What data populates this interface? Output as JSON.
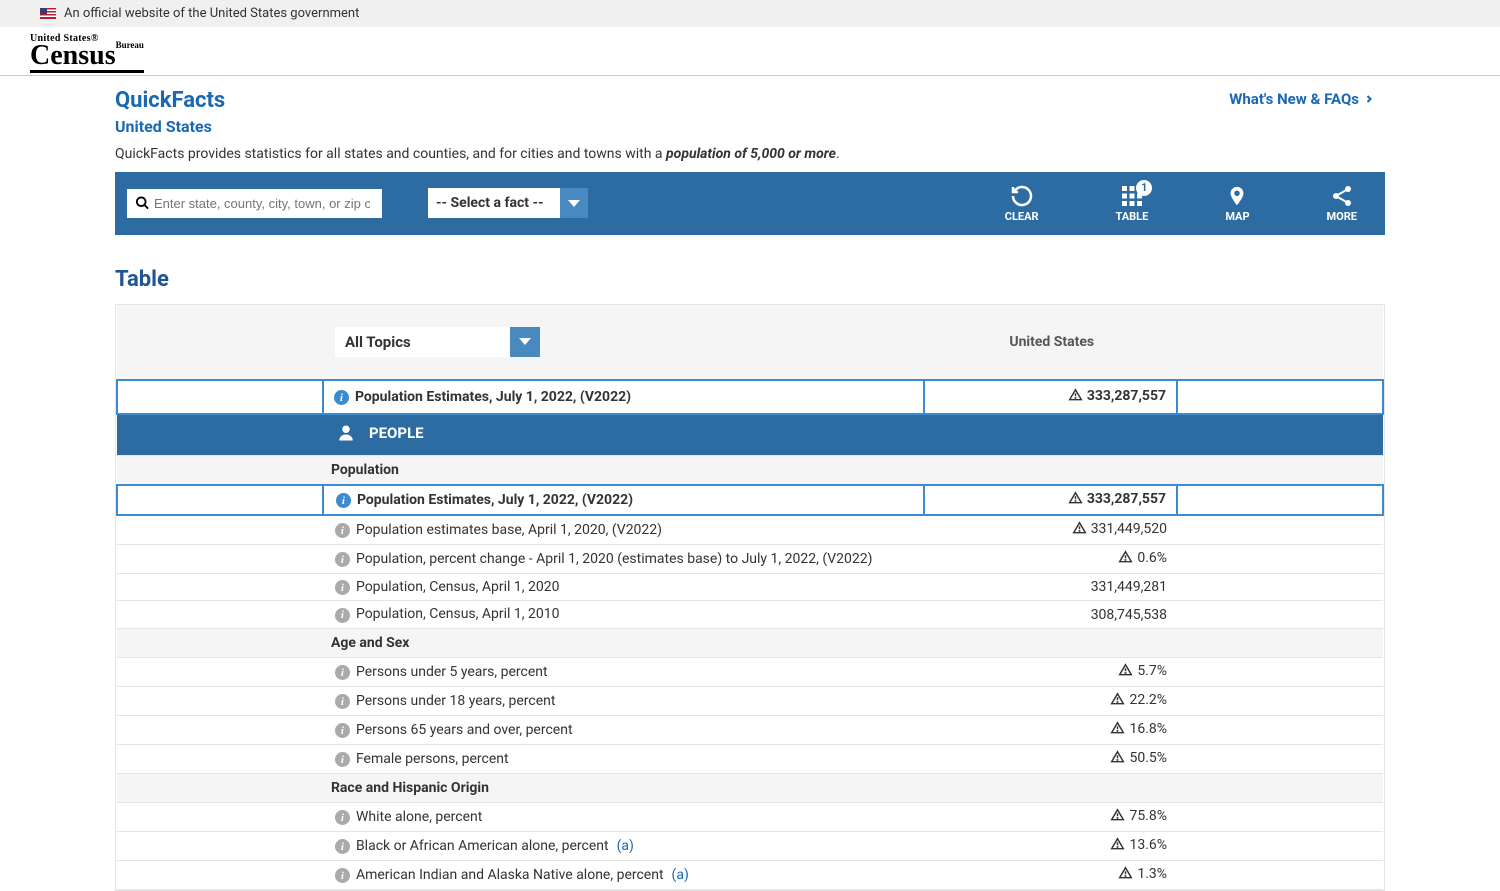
{
  "gov_banner": "An official website of the United States government",
  "header": {
    "logo_small": "United States®",
    "logo_big": "Census",
    "logo_bureau": "Bureau"
  },
  "page": {
    "title": "QuickFacts",
    "subtitle": "United States",
    "desc_prefix": "QuickFacts provides statistics for all states and counties, and for cities and towns with a ",
    "desc_em": "population of 5,000 or more",
    "desc_suffix": ".",
    "whats_new": "What's New & FAQs"
  },
  "toolbar": {
    "search_placeholder": "Enter state, county, city, town, or zip code",
    "fact_select": "-- Select a fact --",
    "clear": "CLEAR",
    "table": "TABLE",
    "table_badge": "1",
    "map": "MAP",
    "more": "MORE"
  },
  "section_title": "Table",
  "topics_select": "All Topics",
  "geo_header": "United States",
  "featured": {
    "label": "Population Estimates, July 1, 2022, (V2022)",
    "value": "333,287,557"
  },
  "category_banner": "PEOPLE",
  "groups": [
    {
      "heading": "Population",
      "rows": [
        {
          "label": "Population Estimates, July 1, 2022, (V2022)",
          "value": "333,287,557",
          "selected": true,
          "warn": true
        },
        {
          "label": "Population estimates base, April 1, 2020, (V2022)",
          "value": "331,449,520",
          "warn": true
        },
        {
          "label": "Population, percent change - April 1, 2020 (estimates base) to July 1, 2022, (V2022)",
          "value": "0.6%",
          "warn": true
        },
        {
          "label": "Population, Census, April 1, 2020",
          "value": "331,449,281"
        },
        {
          "label": "Population, Census, April 1, 2010",
          "value": "308,745,538"
        }
      ]
    },
    {
      "heading": "Age and Sex",
      "rows": [
        {
          "label": "Persons under 5 years, percent",
          "value": "5.7%",
          "warn": true
        },
        {
          "label": "Persons under 18 years, percent",
          "value": "22.2%",
          "warn": true
        },
        {
          "label": "Persons 65 years and over, percent",
          "value": "16.8%",
          "warn": true
        },
        {
          "label": "Female persons, percent",
          "value": "50.5%",
          "warn": true
        }
      ]
    },
    {
      "heading": "Race and Hispanic Origin",
      "rows": [
        {
          "label": "White alone, percent",
          "value": "75.8%",
          "warn": true
        },
        {
          "label": "Black or African American alone, percent",
          "value": "13.6%",
          "warn": true,
          "note": "(a)"
        },
        {
          "label": "American Indian and Alaska Native alone, percent",
          "value": "1.3%",
          "warn": true,
          "note": "(a)"
        }
      ]
    }
  ]
}
